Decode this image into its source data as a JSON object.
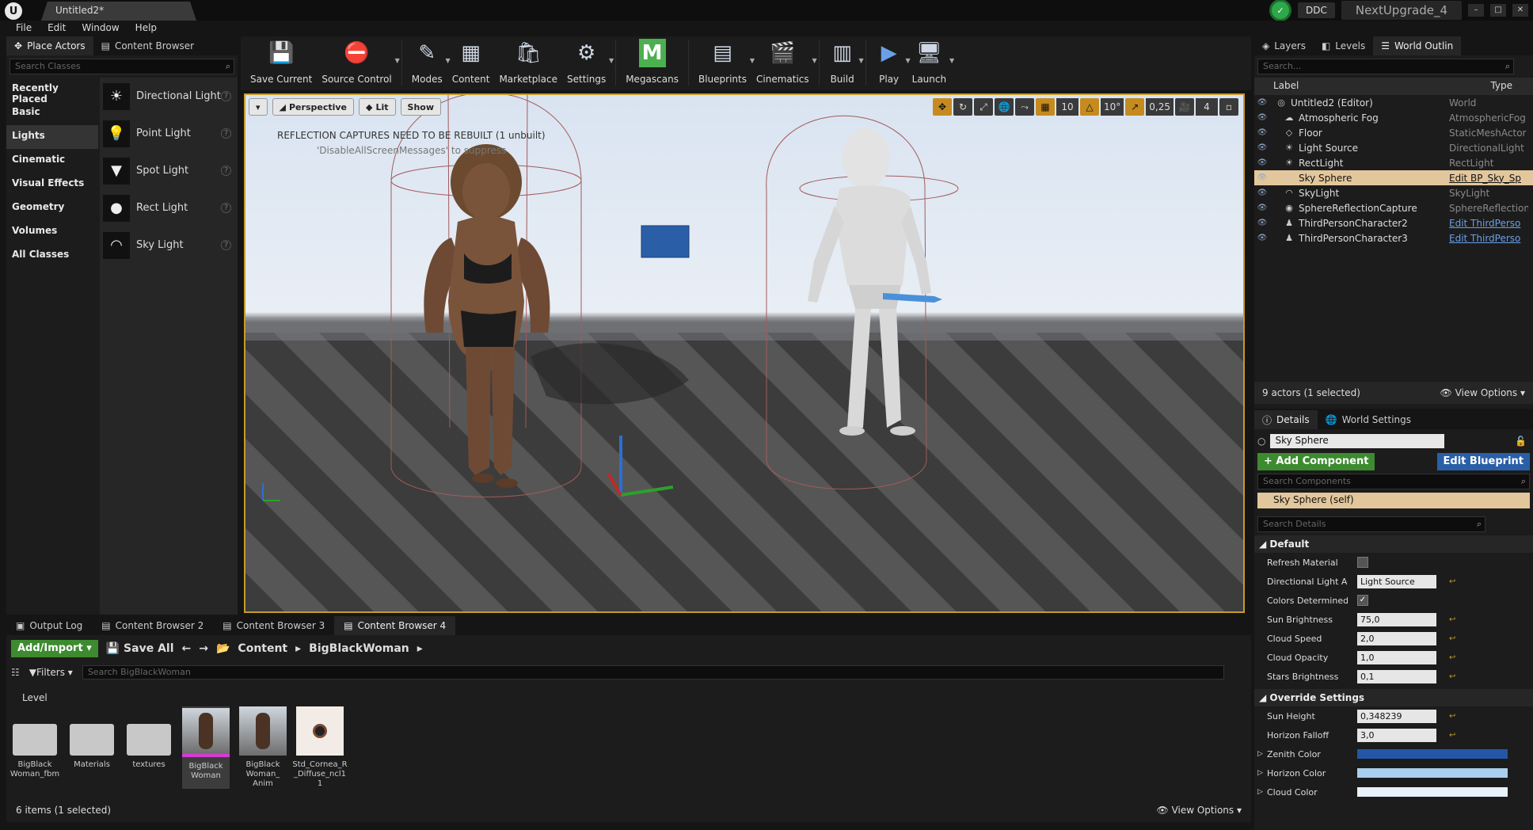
{
  "title_bar": {
    "doc_tab": "Untitled2*",
    "ddc": "DDC",
    "project": "NextUpgrade_4"
  },
  "menu": [
    "File",
    "Edit",
    "Window",
    "Help"
  ],
  "left_panel": {
    "tabs": [
      "Place Actors",
      "Content Browser"
    ],
    "search_placeholder": "Search Classes",
    "categories": [
      "Recently Placed",
      "Basic",
      "Lights",
      "Cinematic",
      "Visual Effects",
      "Geometry",
      "Volumes",
      "All Classes"
    ],
    "active_category": "Lights",
    "actors": [
      {
        "label": "Directional Light",
        "icon": "directional-light-icon",
        "glyph": "☀"
      },
      {
        "label": "Point Light",
        "icon": "point-light-icon",
        "glyph": "💡"
      },
      {
        "label": "Spot Light",
        "icon": "spot-light-icon",
        "glyph": "▼"
      },
      {
        "label": "Rect Light",
        "icon": "rect-light-icon",
        "glyph": "●"
      },
      {
        "label": "Sky Light",
        "icon": "sky-light-icon",
        "glyph": "◠"
      }
    ]
  },
  "toolbar": [
    {
      "label": "Save Current",
      "icon": "save-icon",
      "glyph": "💾"
    },
    {
      "label": "Source Control",
      "icon": "source-control-icon",
      "glyph": "⛔"
    },
    {
      "label": "Modes",
      "icon": "modes-icon",
      "glyph": "✎"
    },
    {
      "label": "Content",
      "icon": "content-icon",
      "glyph": "▦"
    },
    {
      "label": "Marketplace",
      "icon": "marketplace-icon",
      "glyph": "🛍"
    },
    {
      "label": "Settings",
      "icon": "settings-icon",
      "glyph": "⚙"
    },
    {
      "label": "Megascans",
      "icon": "megascans-icon",
      "glyph": "M"
    },
    {
      "label": "Blueprints",
      "icon": "blueprints-icon",
      "glyph": "▤"
    },
    {
      "label": "Cinematics",
      "icon": "cinematics-icon",
      "glyph": "🎬"
    },
    {
      "label": "Build",
      "icon": "build-icon",
      "glyph": "▥"
    },
    {
      "label": "Play",
      "icon": "play-icon",
      "glyph": "▶"
    },
    {
      "label": "Launch",
      "icon": "launch-icon",
      "glyph": "🖥"
    }
  ],
  "viewport": {
    "buttons": [
      "Perspective",
      "Lit",
      "Show"
    ],
    "message": "REFLECTION CAPTURES NEED TO BE REBUILT (1 unbuilt)",
    "submessage": "'DisableAllScreenMessages' to suppress",
    "grid_snap": "10",
    "rot_snap": "10°",
    "scale_snap": "0,25",
    "cam_speed": "4"
  },
  "outliner": {
    "tabs": [
      "Layers",
      "Levels",
      "World Outlin"
    ],
    "search_placeholder": "Search...",
    "col_label": "Label",
    "col_type": "Type",
    "rows": [
      {
        "label": "Untitled2 (Editor)",
        "type": "World",
        "icon": "world-icon",
        "glyph": "◎",
        "link": false,
        "sel": false
      },
      {
        "label": "Atmospheric Fog",
        "type": "AtmosphericFog",
        "icon": "fog-icon",
        "glyph": "☁",
        "link": false,
        "sel": false
      },
      {
        "label": "Floor",
        "type": "StaticMeshActor",
        "icon": "mesh-icon",
        "glyph": "◇",
        "link": false,
        "sel": false
      },
      {
        "label": "Light Source",
        "type": "DirectionalLight",
        "icon": "directional-light-icon",
        "glyph": "☀",
        "link": false,
        "sel": false
      },
      {
        "label": "RectLight",
        "type": "RectLight",
        "icon": "rect-light-icon",
        "glyph": "☀",
        "link": false,
        "sel": false
      },
      {
        "label": "Sky Sphere",
        "type": "Edit BP_Sky_Sp",
        "icon": "sphere-icon",
        "glyph": "○",
        "link": true,
        "sel": true
      },
      {
        "label": "SkyLight",
        "type": "SkyLight",
        "icon": "sky-light-icon",
        "glyph": "◠",
        "link": false,
        "sel": false
      },
      {
        "label": "SphereReflectionCapture",
        "type": "SphereReflection",
        "icon": "reflection-icon",
        "glyph": "◉",
        "link": false,
        "sel": false
      },
      {
        "label": "ThirdPersonCharacter2",
        "type": "Edit ThirdPerso",
        "icon": "character-icon",
        "glyph": "♟",
        "link": true,
        "sel": false
      },
      {
        "label": "ThirdPersonCharacter3",
        "type": "Edit ThirdPerso",
        "icon": "character-icon",
        "glyph": "♟",
        "link": true,
        "sel": false
      }
    ],
    "footer_count": "9 actors (1 selected)",
    "view_options": "View Options"
  },
  "details": {
    "tabs": [
      "Details",
      "World Settings"
    ],
    "name": "Sky Sphere",
    "add_component": "+ Add Component",
    "edit_blueprint": "Edit Blueprint",
    "search_components": "Search Components",
    "self_component": "Sky Sphere (self)",
    "search_details": "Search Details",
    "default_section": "Default",
    "override_section": "Override Settings",
    "default_props": [
      {
        "label": "Refresh Material",
        "kind": "check",
        "value": ""
      },
      {
        "label": "Directional Light Ac",
        "kind": "select",
        "value": "Light Source"
      },
      {
        "label": "Colors Determined I",
        "kind": "check",
        "value": "✓"
      },
      {
        "label": "Sun Brightness",
        "kind": "num",
        "value": "75,0"
      },
      {
        "label": "Cloud Speed",
        "kind": "num",
        "value": "2,0"
      },
      {
        "label": "Cloud Opacity",
        "kind": "num",
        "value": "1,0"
      },
      {
        "label": "Stars Brightness",
        "kind": "num",
        "value": "0,1"
      }
    ],
    "override_props": [
      {
        "label": "Sun Height",
        "kind": "num",
        "value": "0,348239"
      },
      {
        "label": "Horizon Falloff",
        "kind": "num",
        "value": "3,0"
      },
      {
        "label": "Zenith Color",
        "kind": "color",
        "value": "",
        "color": "#2456a8"
      },
      {
        "label": "Horizon Color",
        "kind": "color",
        "value": "",
        "color": "#a9cfee"
      },
      {
        "label": "Cloud Color",
        "kind": "color",
        "value": "",
        "color": "#e8f2fb"
      }
    ]
  },
  "content_browser": {
    "tabs": [
      "Output Log",
      "Content Browser 2",
      "Content Browser 3",
      "Content Browser 4"
    ],
    "add_import": "Add/Import",
    "save_all": "Save All",
    "crumbs": [
      "Content",
      "BigBlackWoman"
    ],
    "filters": "Filters",
    "search_placeholder": "Search BigBlackWoman",
    "level_label": "Level",
    "assets": [
      {
        "label": "BigBlack Woman_fbm",
        "kind": "folder"
      },
      {
        "label": "Materials",
        "kind": "folder"
      },
      {
        "label": "textures",
        "kind": "folder"
      },
      {
        "label": "BigBlack Woman",
        "kind": "mesh",
        "sel": true
      },
      {
        "label": "BigBlack Woman_ Anim",
        "kind": "anim"
      },
      {
        "label": "Std_Cornea_R _Diffuse_ncl1 1",
        "kind": "texture"
      }
    ],
    "status": "6 items (1 selected)",
    "view_options": "View Options"
  },
  "colors": {
    "accent": "#c89b2a",
    "selection": "#e3c79c",
    "green": "#3d8b2f",
    "blue": "#2a5fa8"
  }
}
